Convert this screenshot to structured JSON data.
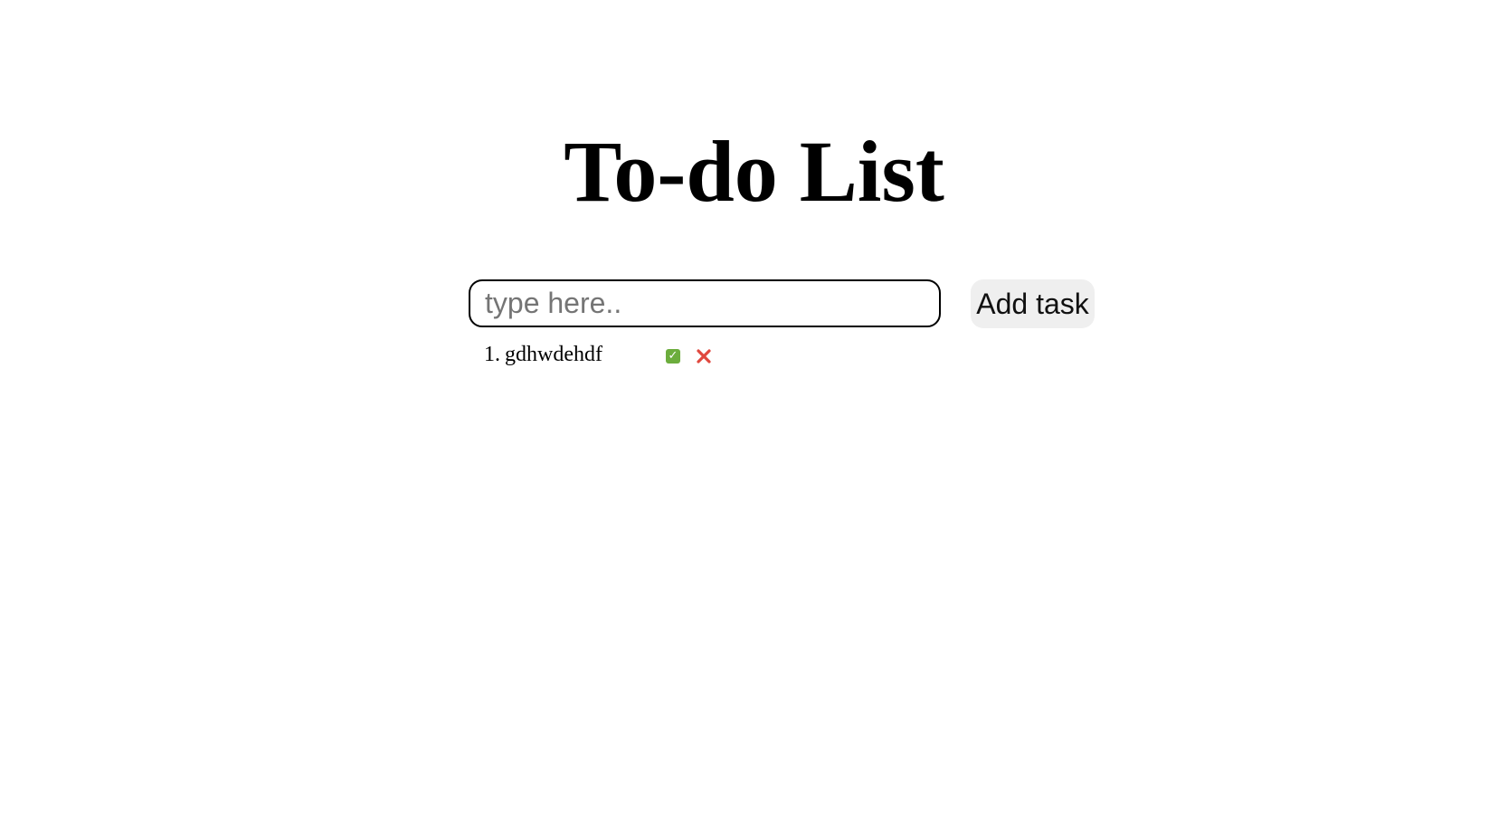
{
  "header": {
    "title": "To-do List"
  },
  "form": {
    "input_placeholder": "type here..",
    "input_value": "",
    "add_button_label": "Add task"
  },
  "tasks": [
    {
      "number": "1.",
      "text": "gdhwdehdf",
      "complete_icon": "check-mark-icon",
      "delete_icon": "cross-icon"
    }
  ],
  "colors": {
    "complete_icon": "#6cad3d",
    "delete_icon": "#e0483e",
    "button_background": "#efefef"
  }
}
